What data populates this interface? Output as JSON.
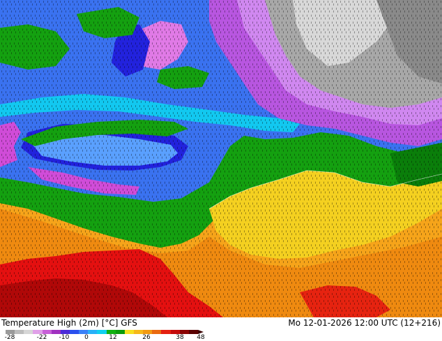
{
  "map": {
    "colors": {
      "deep_cold": "#d04cd8",
      "cold_pink": "#e07ae6",
      "blue_dark": "#2222dd",
      "blue": "#3a72f0",
      "sky": "#5aa0ff",
      "cyan": "#12c8f0",
      "green": "#14a010",
      "green_dark": "#0a7e0a",
      "yellow": "#f4d020",
      "orange": "#f6a41a",
      "orange_dark": "#ef8a10",
      "red": "#e41010",
      "dark_red": "#b00808",
      "gray_light": "#d8d8d8",
      "gray": "#a8a8a8",
      "gray_dark": "#8a8a8a",
      "lilac": "#b856e0",
      "lilac_light": "#d088f0"
    }
  },
  "footer": {
    "title": "Temperature High (2m) [°C] GFS",
    "valid_time": "Mo 12-01-2026 12:00 UTC (12+216)"
  },
  "legend": {
    "ticks": [
      "-28",
      "-22",
      "-10",
      "0",
      "12",
      "26",
      "38",
      "48"
    ],
    "colors": [
      "#9a9a9a",
      "#bcbcbc",
      "#d6d6d6",
      "#e0a0e8",
      "#c860d8",
      "#a030c0",
      "#4a2ad8",
      "#2a50ee",
      "#3a80f8",
      "#28b0f8",
      "#10d0f0",
      "#10b010",
      "#0a9a0a",
      "#f6e020",
      "#f6b81a",
      "#f29a12",
      "#ea6a10",
      "#e42010",
      "#c40a0a",
      "#8a0404",
      "#5a0202"
    ]
  }
}
